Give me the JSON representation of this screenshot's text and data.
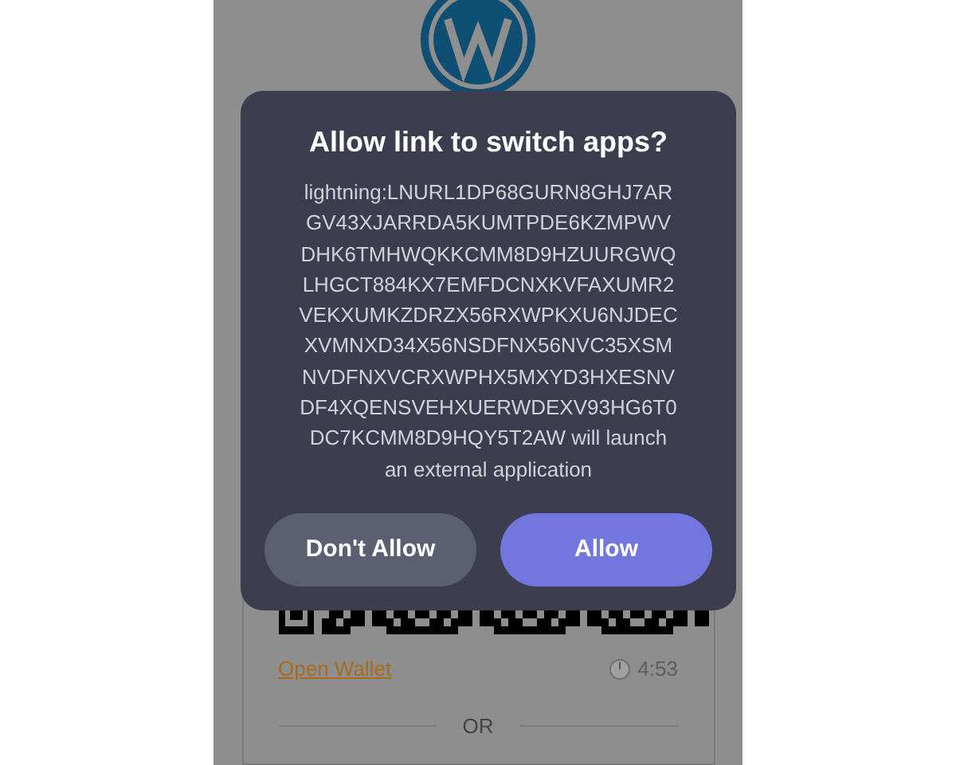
{
  "dialog": {
    "title": "Allow link to switch apps?",
    "message": "lightning:LNURL1DP68GURN8GHJ7ARGV43XJARRDA5KUMTPDE6KZMPWVDHK6TMHWQKKCMM8D9HZUURGWQLHGCT884KX7EMFDCNXKVFAXUMR2VEKXUMKZDRZX56RXWPKXU6NJDECXVMNXD34X56NSDFNX56NVC35XSMNVDFNXVCRXWPHX5MXYD3HXESNVDF4XQENSVEHXUERWDEXV93HG6T0DC7KCMM8D9HQY5T2AW will launch an external application",
    "buttons": [
      {
        "label": "Don't Allow",
        "kind": "secondary"
      },
      {
        "label": "Allow",
        "kind": "primary"
      }
    ]
  },
  "payment": {
    "link": "Open Wallet",
    "timer": "4:53",
    "divider": "OR"
  }
}
